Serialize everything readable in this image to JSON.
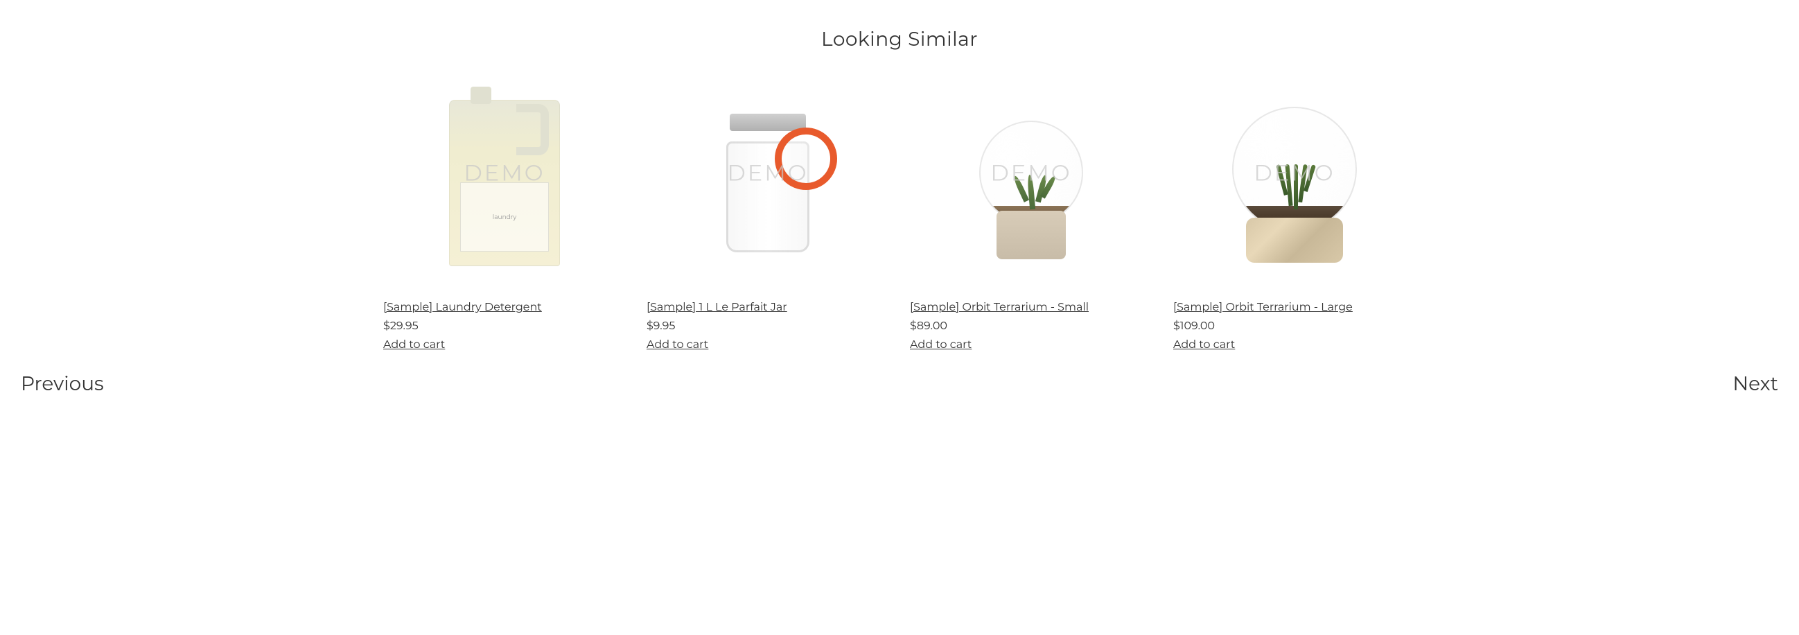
{
  "section_title": "Looking Similar",
  "watermark": "DEMO",
  "products": [
    {
      "name": "[Sample] Laundry Detergent",
      "price": "$29.95",
      "cta": "Add to cart"
    },
    {
      "name": "[Sample] 1 L Le Parfait Jar",
      "price": "$9.95",
      "cta": "Add to cart"
    },
    {
      "name": "[Sample] Orbit Terrarium - Small",
      "price": "$89.00",
      "cta": "Add to cart"
    },
    {
      "name": "[Sample] Orbit Terrarium - Large",
      "price": "$109.00",
      "cta": "Add to cart"
    }
  ],
  "navigation": {
    "prev": "Previous",
    "next": "Next"
  }
}
